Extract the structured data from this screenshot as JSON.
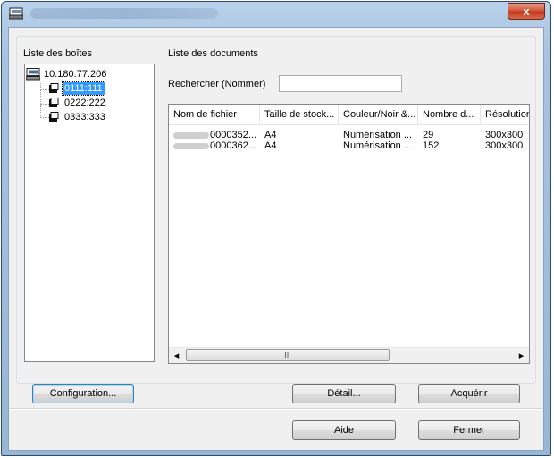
{
  "window": {
    "title": "",
    "close_glyph": "x"
  },
  "boxes": {
    "label": "Liste des boîtes",
    "root": "10.180.77.206",
    "items": [
      "0111:111",
      "0222:222",
      "0333:333"
    ],
    "selected_index": 0
  },
  "documents": {
    "label": "Liste des documents",
    "search_label": "Rechercher (Nommer)",
    "search_value": "",
    "columns": [
      "Nom de fichier",
      "Taille de stock...",
      "Couleur/Noir &...",
      "Nombre d...",
      "Résolution"
    ],
    "rows": [
      [
        "0000352...",
        "A4",
        "Numérisation ...",
        "29",
        "300x300"
      ],
      [
        "0000362...",
        "A4",
        "Numérisation ...",
        "152",
        "300x300"
      ]
    ],
    "scroll_grip": "III",
    "scroll_left_glyph": "◂",
    "scroll_right_glyph": "▸"
  },
  "buttons": {
    "configuration": "Configuration...",
    "detail": "Détail...",
    "acquire": "Acquérir",
    "help": "Aide",
    "close": "Fermer"
  },
  "icons": {
    "app": "scanner-icon",
    "root": "network-computer-icon",
    "box": "document-box-icon"
  },
  "colors": {
    "selection": "#3399ff",
    "close_button": "#c0391c",
    "title_bar": "#a7c3e0"
  }
}
